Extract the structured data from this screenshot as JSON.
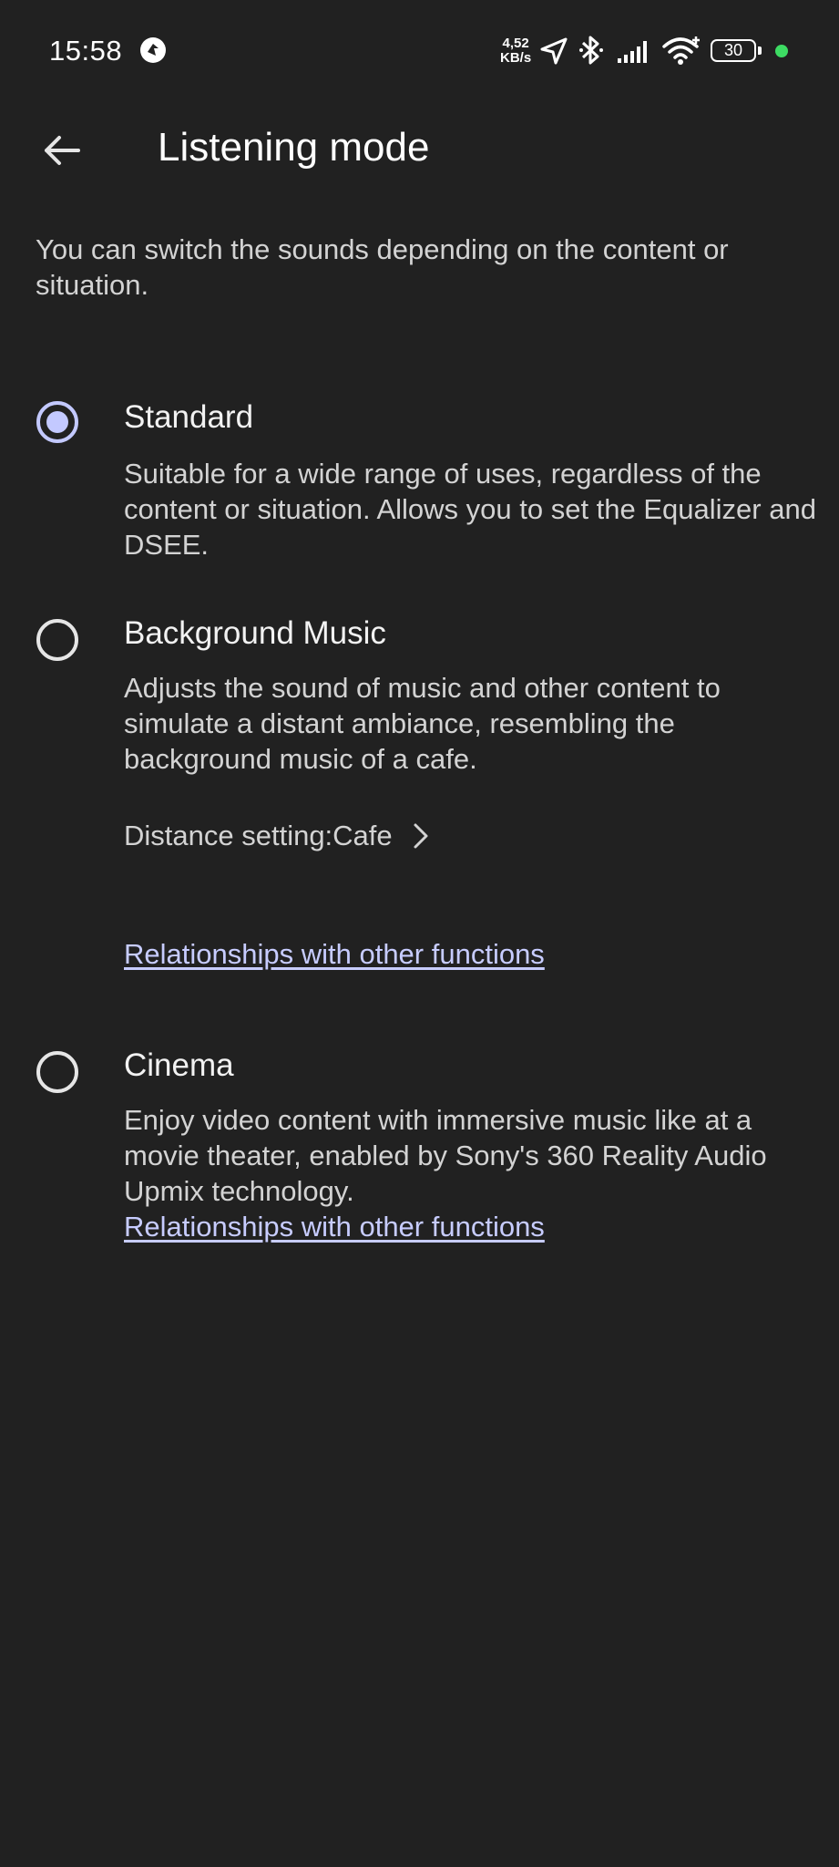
{
  "status_bar": {
    "time": "15:58",
    "net_speed_value": "4,52",
    "net_speed_unit": "KB/s",
    "battery_level": "30",
    "icons": [
      "assistant-icon",
      "location-arrow-icon",
      "bluetooth-icon",
      "signal-bars-icon",
      "wifi-icon",
      "battery-icon",
      "active-dot"
    ],
    "dot_color": "#3ddc63"
  },
  "app_bar": {
    "back_icon": "arrow-left-icon",
    "title": "Listening mode"
  },
  "intro": "You can switch the sounds depending on the content or situation.",
  "options": [
    {
      "label": "Standard",
      "selected": true,
      "description": "Suitable for a wide range of uses, regardless of the content or situation. Allows you to set the Equalizer and DSEE."
    },
    {
      "label": "Background Music",
      "selected": false,
      "description": "Adjusts the sound of music and other content to simulate a distant ambiance, resembling the background music of a cafe.",
      "setting_label": "Distance setting:Cafe",
      "link": "Relationships with other functions"
    },
    {
      "label": "Cinema",
      "selected": false,
      "description": "Enjoy video content with immersive music like at a movie theater, enabled by Sony's 360 Reality Audio Upmix technology.",
      "link": "Relationships with other functions"
    }
  ],
  "colors": {
    "background": "#212121",
    "accent": "#c3c9ff",
    "link": "#c7ccff",
    "secondary_text": "#d3d3d3"
  }
}
